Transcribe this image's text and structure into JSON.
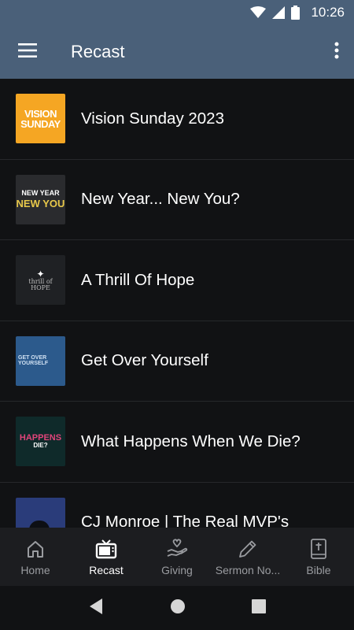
{
  "status_bar": {
    "time": "10:26"
  },
  "app_bar": {
    "title": "Recast"
  },
  "items": [
    {
      "title": "Vision Sunday 2023",
      "thumb_line1": "VISION",
      "thumb_line2": "SUNDAY"
    },
    {
      "title": "New Year... New You?",
      "thumb_line1": "NEW YEAR",
      "thumb_line2": "NEW YOU"
    },
    {
      "title": "A Thrill Of Hope",
      "thumb_line1": "thrill of",
      "thumb_line2": "HOPE"
    },
    {
      "title": "Get Over Yourself",
      "thumb_line1": "GET OVER",
      "thumb_line2": "YOURSELF"
    },
    {
      "title": "What Happens When We Die?",
      "thumb_line1": "HAPPENS",
      "thumb_line2": "DIE?"
    },
    {
      "title": "CJ Monroe | The Real MVP's"
    }
  ],
  "bottom_nav": [
    {
      "label": "Home",
      "icon": "home-icon"
    },
    {
      "label": "Recast",
      "icon": "tv-icon",
      "active": true
    },
    {
      "label": "Giving",
      "icon": "giving-hand-icon"
    },
    {
      "label": "Sermon No...",
      "icon": "pencil-icon"
    },
    {
      "label": "Bible",
      "icon": "bible-icon"
    }
  ],
  "colors": {
    "app_bar": "#4a6079",
    "background": "#111214",
    "nav_bg": "#1c1d20",
    "nav_inactive": "#9a9ca0"
  }
}
